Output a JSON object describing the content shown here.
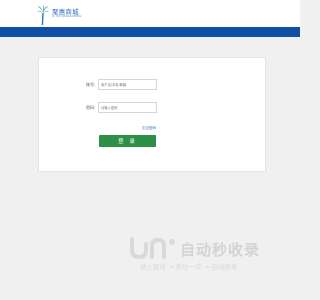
{
  "header": {
    "logo_text": "聚惠商城",
    "logo_subtext": "JU HUI SHANGCHENG",
    "brand_color": "#2a6fc2",
    "bar_color": "#0f4fa8"
  },
  "login": {
    "account_label": "账号:",
    "account_placeholder": "用户名/手机/邮箱",
    "password_label": "密码:",
    "password_placeholder": "请输入密码",
    "forgot_link": "忘记密码",
    "submit_label": "登 录",
    "button_color": "#2e8f46"
  },
  "watermark": {
    "title": "自动秒收录",
    "subtitle": "做上链接 → 来访一次 → 自动收录"
  }
}
